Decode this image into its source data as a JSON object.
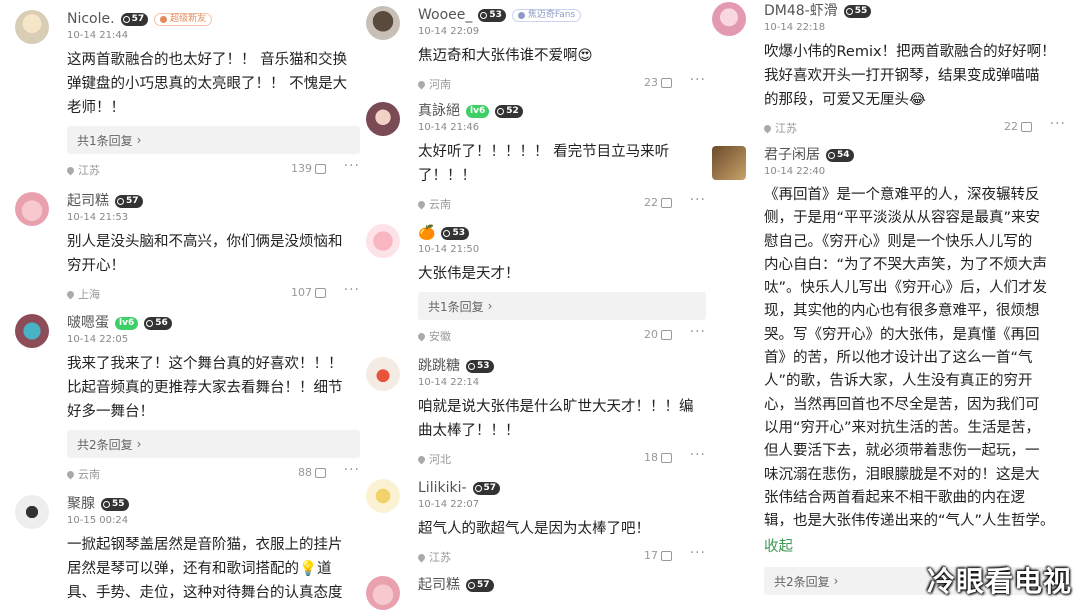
{
  "colors": {
    "text": "#222222",
    "meta": "#999999",
    "reply_bg": "#f2f2f2",
    "vip_green": "#3ecf66",
    "link_green": "#3a9a53"
  },
  "icons": [
    "location-pin-icon",
    "thumb-up-icon",
    "more-options-icon",
    "level-badge-icon"
  ],
  "col1": {
    "c1": {
      "name": "Nicole.",
      "level": "57",
      "fan_badge": "超级新友",
      "time": "10-14 21:44",
      "lines": [
        "这两首歌融合的也太好了！！ 音乐猫和交换",
        "弹键盘的小巧思真的太亮眼了！！ 不愧是大",
        "老师！！"
      ],
      "replies": "共1条回复",
      "location": "江苏",
      "likes": "139"
    },
    "c2": {
      "name": "起司糕",
      "level": "57",
      "time": "10-14 21:53",
      "lines": [
        "别人是没头脑和不高兴，你们俩是没烦恼和",
        "穷开心！"
      ],
      "location": "上海",
      "likes": "107"
    },
    "c3": {
      "name": "啵嗯蛋",
      "vip": "lv6",
      "level": "56",
      "time": "10-14 22:05",
      "lines": [
        "我来了我来了！这个舞台真的好喜欢！！！",
        "比起音频真的更推荐大家去看舞台！！细节",
        "好多一舞台！"
      ],
      "replies": "共2条回复",
      "location": "云南",
      "likes": "88"
    },
    "c4": {
      "name": "聚腺",
      "level": "55",
      "time": "10-15 00:24",
      "lines": [
        "一掀起钢琴盖居然是音阶猫，衣服上的挂片",
        "居然是琴可以弹，还有和歌词搭配的💡道",
        "具、手势、走位，这种对待舞台的认真态度"
      ]
    }
  },
  "col2": {
    "c1": {
      "name": "Wooee_",
      "level": "53",
      "fan_badge": "焦迈奇Fans",
      "time": "10-14 22:09",
      "lines": [
        "焦迈奇和大张伟谁不爱啊😍"
      ],
      "location": "河南",
      "likes": "23"
    },
    "c2": {
      "name": "真詠絕",
      "vip": "lv6",
      "level": "52",
      "time": "10-14 21:46",
      "lines": [
        "太好听了！！！！！ 看完节目立马来听",
        "了！！！"
      ],
      "location": "云南",
      "likes": "22"
    },
    "c3": {
      "name": "🍊",
      "level": "53",
      "time": "10-14 21:50",
      "lines": [
        "大张伟是天才！"
      ],
      "replies": "共1条回复",
      "location": "安徽",
      "likes": "20"
    },
    "c4": {
      "name": "跳跳糖",
      "level": "53",
      "time": "10-14 22:14",
      "lines": [
        "咱就是说大张伟是什么旷世大天才！！！编",
        "曲太棒了！！！"
      ],
      "location": "河北",
      "likes": "18"
    },
    "c5": {
      "name": "Lilikiki-",
      "level": "57",
      "time": "10-14 22:07",
      "lines": [
        "超气人的歌超气人是因为太棒了吧！"
      ],
      "location": "江苏",
      "likes": "17"
    },
    "c6": {
      "name": "起司糕",
      "level": "57"
    }
  },
  "col3": {
    "c1": {
      "name": "DM48-虾滑",
      "level": "55",
      "time": "10-14 22:18",
      "lines": [
        "吹爆小伟的Remix！把两首歌融合的好好啊！",
        "我好喜欢开头一打开钢琴，结果变成弹喵喵",
        "的那段，可爱又无厘头😂"
      ],
      "location": "江苏",
      "likes": "22"
    },
    "c2": {
      "name": "君子闲居",
      "level": "54",
      "time": "10-14 22:40",
      "lines": [
        "《再回首》是一个意难平的人，深夜辗转反",
        "侧，于是用“平平淡淡从从容容是最真”来安",
        "慰自己。《穷开心》则是一个快乐人儿写的",
        "内心自白：“为了不哭大声笑，为了不烦大声",
        "呔”。快乐人儿写出《穷开心》后，人们才发",
        "现，其实他的内心也有很多意难平，很烦想",
        "哭。写《穷开心》的大张伟，是真懂《再回",
        "首》的苦，所以他才设计出了这么一首“气",
        "人”的歌，告诉大家，人生没有真正的穷开",
        "心，当然再回首也不尽全是苦，因为我们可",
        "以用“穷开心”来对抗生活的苦。生活是苦，",
        "但人要活下去，就必须带着悲伤一起玩，一",
        "味沉溺在悲伤，泪眼朦胧是不对的！这是大",
        "张伟结合两首看起来不相干歌曲的内在逻",
        "辑，也是大张伟传递出来的“气人”人生哲学。"
      ],
      "collapse": "收起",
      "replies": "共2条回复"
    }
  },
  "watermark": "冷眼看电视"
}
